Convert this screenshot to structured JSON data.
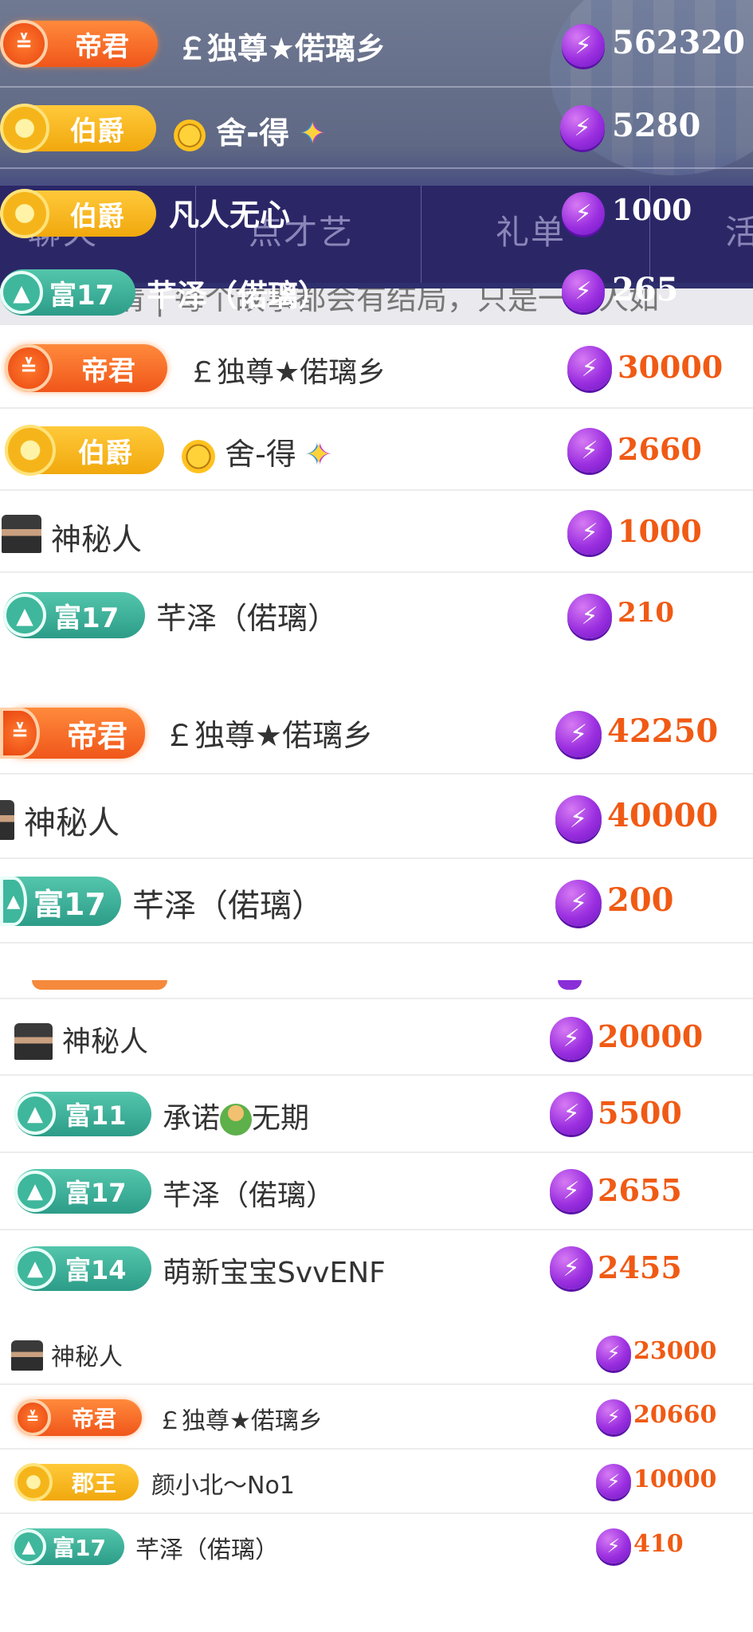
{
  "tabs": [
    "聊天",
    "点才艺",
    "礼单",
    "活"
  ],
  "marquee": "钱迎东倩 | 每个故事都会有结局，只是一有人如",
  "dark_rows": [
    {
      "badge": "帝君",
      "name": "￡独尊★偌璃乡",
      "value": "562320"
    },
    {
      "badge": "伯爵",
      "name": "舍-得",
      "value": "5280"
    },
    {
      "badge": "伯爵",
      "name": "凡人无心",
      "value": "1000"
    },
    {
      "badge": "富17",
      "name": "芊泽（偌璃）",
      "value": "265"
    }
  ],
  "list1": [
    {
      "badge": "帝君",
      "name": "￡独尊★偌璃乡",
      "value": "30000"
    },
    {
      "badge": "伯爵",
      "name": "舍-得",
      "value": "2660"
    },
    {
      "badge": "",
      "name": "神秘人",
      "value": "1000"
    },
    {
      "badge": "富17",
      "name": "芊泽（偌璃）",
      "value": "210"
    }
  ],
  "list2": [
    {
      "badge": "帝君",
      "name": "￡独尊★偌璃乡",
      "value": "42250"
    },
    {
      "badge": "",
      "name": "神秘人",
      "value": "40000"
    },
    {
      "badge": "富17",
      "name": "芊泽（偌璃）",
      "value": "200"
    }
  ],
  "list3": [
    {
      "badge": "",
      "name": "神秘人",
      "value": "20000"
    },
    {
      "badge": "富11",
      "name": "承诺",
      "name_suffix": "无期",
      "value": "5500"
    },
    {
      "badge": "富17",
      "name": "芊泽（偌璃）",
      "value": "2655"
    },
    {
      "badge": "富14",
      "name": "萌新宝宝SvvENF",
      "value": "2455"
    }
  ],
  "list4": [
    {
      "badge": "",
      "name": "神秘人",
      "value": "23000"
    },
    {
      "badge": "帝君",
      "name": "￡独尊★偌璃乡",
      "value": "20660"
    },
    {
      "badge": "郡王",
      "name": "颜小北～No1",
      "value": "10000"
    },
    {
      "badge": "富17",
      "name": "芊泽（偌璃）",
      "value": "410"
    }
  ],
  "colors": {
    "value_orange": "#f05a14",
    "badge_orange": "#f0561a",
    "badge_gold": "#f1a80d",
    "badge_teal": "#2c9c88",
    "bolt_purple": "#9b2fe0"
  }
}
